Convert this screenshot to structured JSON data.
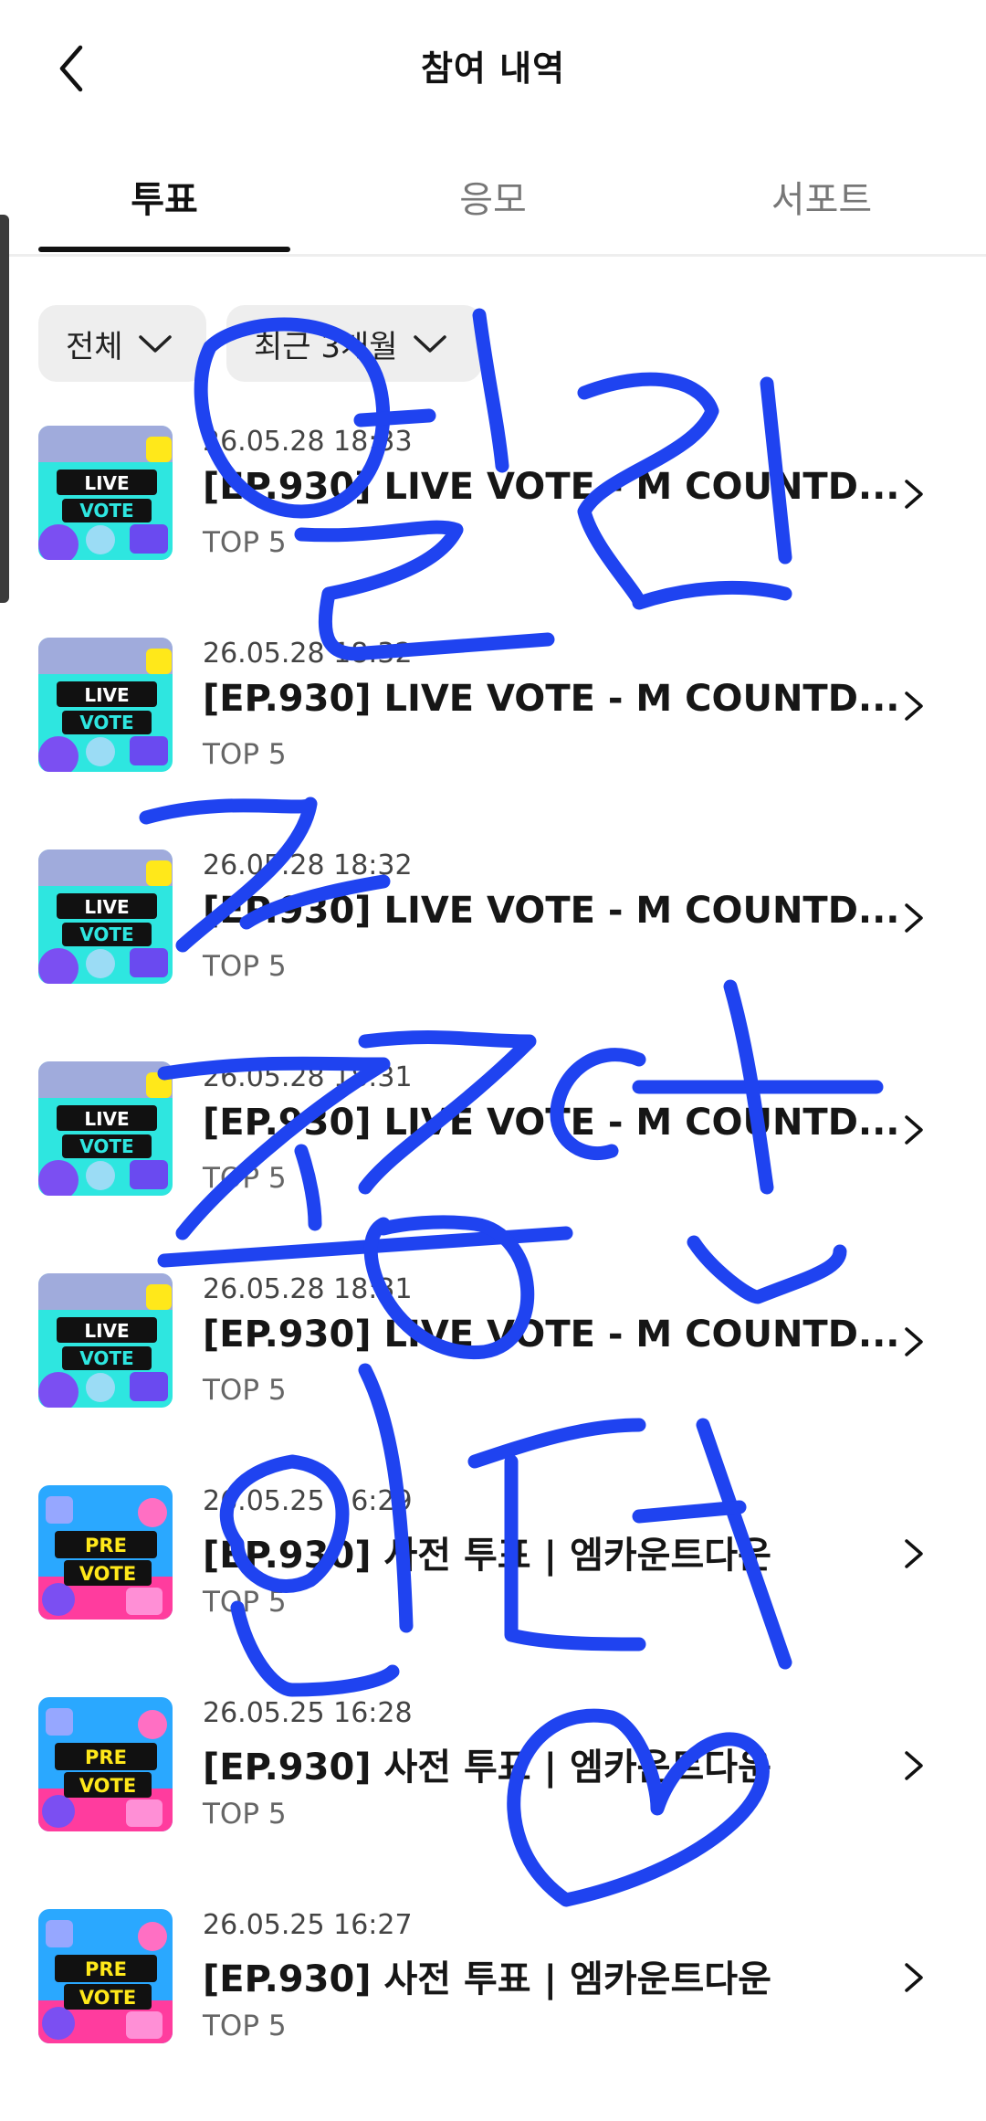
{
  "header": {
    "title": "참여 내역",
    "back_icon": "chevron-left-icon"
  },
  "tabs": [
    {
      "label": "투표",
      "active": true
    },
    {
      "label": "응모",
      "active": false
    },
    {
      "label": "서포트",
      "active": false
    }
  ],
  "filters": [
    {
      "label": "전체",
      "icon": "chevron-down-icon"
    },
    {
      "label": "최근 3개월",
      "icon": "chevron-down-icon"
    }
  ],
  "items": [
    {
      "date": "26.05.28 18:33",
      "name": "[EP.930] LIVE VOTE - M COUNTD...",
      "sub": "TOP 5",
      "thumb": {
        "kind": "live",
        "line1": "LIVE",
        "line2": "VOTE"
      }
    },
    {
      "date": "26.05.28 18:32",
      "name": "[EP.930] LIVE VOTE - M COUNTD...",
      "sub": "TOP 5",
      "thumb": {
        "kind": "live",
        "line1": "LIVE",
        "line2": "VOTE"
      }
    },
    {
      "date": "26.05.28 18:32",
      "name": "[EP.930] LIVE VOTE - M COUNTD...",
      "sub": "TOP 5",
      "thumb": {
        "kind": "live",
        "line1": "LIVE",
        "line2": "VOTE"
      }
    },
    {
      "date": "26.05.28 18:31",
      "name": "[EP.930] LIVE VOTE - M COUNTD...",
      "sub": "TOP 5",
      "thumb": {
        "kind": "live",
        "line1": "LIVE",
        "line2": "VOTE"
      }
    },
    {
      "date": "26.05.28 18:31",
      "name": "[EP.930] LIVE VOTE - M COUNTD...",
      "sub": "TOP 5",
      "thumb": {
        "kind": "live",
        "line1": "LIVE",
        "line2": "VOTE"
      }
    },
    {
      "date": "26.05.25 16:29",
      "name": "[EP.930] 사전 투표 | 엠카운트다운",
      "sub": "TOP 5",
      "thumb": {
        "kind": "pre",
        "line1": "PRE",
        "line2": "VOTE"
      }
    },
    {
      "date": "26.05.25 16:28",
      "name": "[EP.930] 사전 투표 | 엠카운트다운",
      "sub": "TOP 5",
      "thumb": {
        "kind": "pre",
        "line1": "PRE",
        "line2": "VOTE"
      }
    },
    {
      "date": "26.05.25 16:27",
      "name": "[EP.930] 사전 투표 | 엠카운트다운",
      "sub": "TOP 5",
      "thumb": {
        "kind": "pre",
        "line1": "PRE",
        "line2": "VOTE"
      }
    }
  ],
  "colors": {
    "scribble": "#1f43f0",
    "live_bg": "#2ee6e0",
    "pre_bg": "#2aa8ff",
    "pre_label": "#ffe81a"
  }
}
